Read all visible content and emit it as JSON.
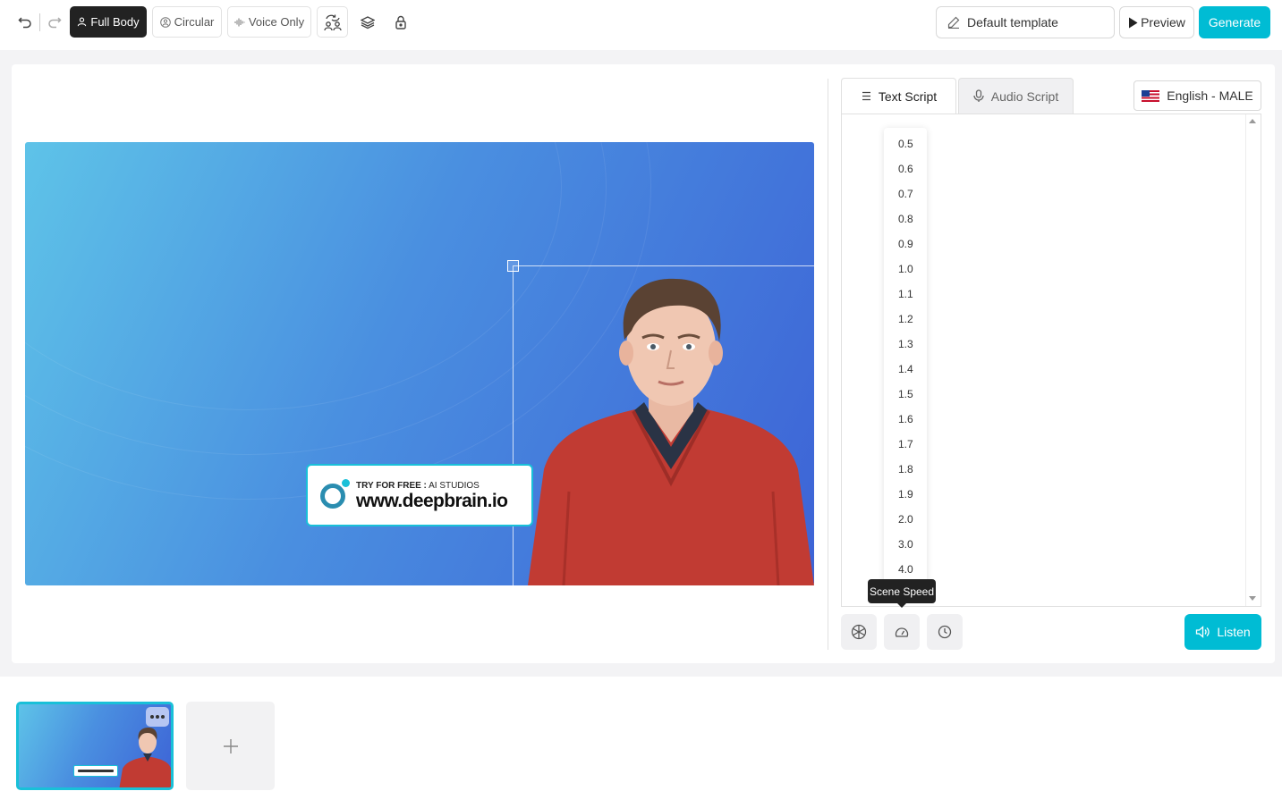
{
  "toolbar": {
    "full_body_label": "Full Body",
    "circular_label": "Circular",
    "voice_only_label": "Voice Only",
    "template_label": "Default template",
    "preview_label": "Preview",
    "generate_label": "Generate"
  },
  "canvas": {
    "banner_prefix": "TRY FOR FREE :",
    "banner_suffix": "AI STUDIOS",
    "banner_url": "www.deepbrain.io"
  },
  "script_panel": {
    "tabs": [
      {
        "label": "Text Script",
        "active": true
      },
      {
        "label": "Audio Script",
        "active": false
      }
    ],
    "language_label": "English - MALE",
    "speed_options": [
      "0.5",
      "0.6",
      "0.7",
      "0.8",
      "0.9",
      "1.0",
      "1.1",
      "1.2",
      "1.3",
      "1.4",
      "1.5",
      "1.6",
      "1.7",
      "1.8",
      "1.9",
      "2.0",
      "3.0",
      "4.0"
    ],
    "tooltip": "Scene Speed",
    "listen_label": "Listen"
  },
  "colors": {
    "accent": "#00bcd4",
    "active_button": "#222222",
    "thumbnail_border": "#19c0d8"
  }
}
